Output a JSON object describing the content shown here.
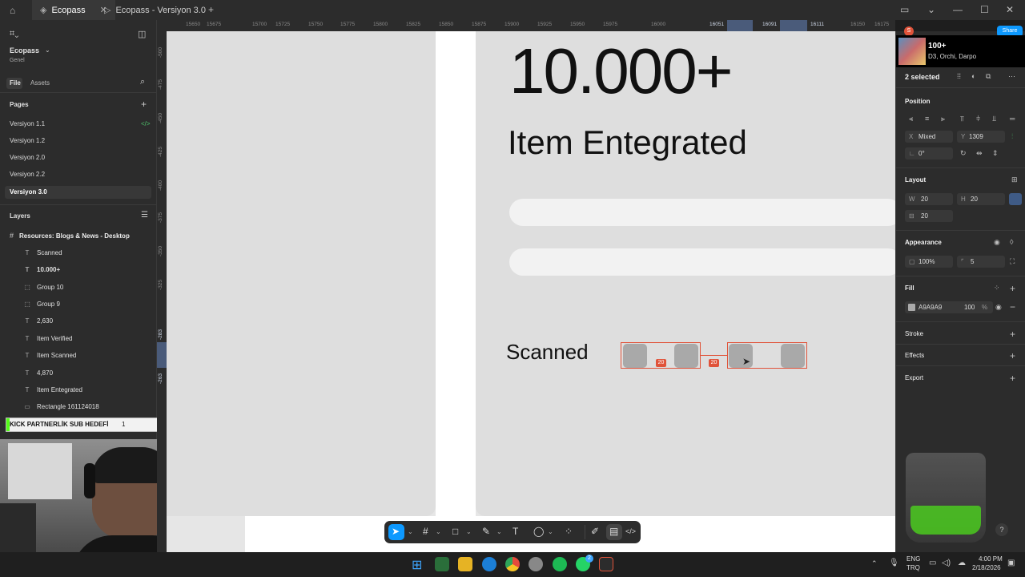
{
  "tabs": [
    {
      "label": "Ecopass",
      "active": true
    },
    {
      "label": "Ecopass - Versiyon 3.0",
      "active": false
    }
  ],
  "left_panel": {
    "project_name": "Ecopass",
    "team": "Genel",
    "tab_file": "File",
    "tab_assets": "Assets",
    "pages_header": "Pages",
    "pages": [
      "Versiyon 1.1",
      "Versiyon 1.2",
      "Versiyon 2.0",
      "Versiyon 2.2",
      "Versiyon 3.0"
    ],
    "layers_header": "Layers",
    "frame_name": "Resources: Blogs & News - Desktop",
    "layers": [
      {
        "icon": "text-icon",
        "label": "Scanned"
      },
      {
        "icon": "text-icon",
        "label": "10.000+"
      },
      {
        "icon": "group-icon",
        "label": "Group 10"
      },
      {
        "icon": "group-icon",
        "label": "Group 9"
      },
      {
        "icon": "text-icon",
        "label": "2,630"
      },
      {
        "icon": "text-icon",
        "label": "Item Verified"
      },
      {
        "icon": "text-icon",
        "label": "Item Scanned"
      },
      {
        "icon": "text-icon",
        "label": "4,870"
      },
      {
        "icon": "text-icon",
        "label": "Item Entegrated"
      },
      {
        "icon": "rect-icon",
        "label": "Rectangle 161124018"
      }
    ]
  },
  "overlay_bar": {
    "label": "KICK PARTNERLİK SUB HEDEFİ",
    "current": "1",
    "target": "25"
  },
  "ruler_top": [
    "15650",
    "15675",
    "15700",
    "15725",
    "15750",
    "15775",
    "15800",
    "15825",
    "15850",
    "15875",
    "15900",
    "15925",
    "15950",
    "15975",
    "16000",
    "16051",
    "16091",
    "16111",
    "16150",
    "16175"
  ],
  "ruler_left": [
    "-500",
    "-475",
    "-450",
    "-425",
    "-400",
    "-375",
    "-350",
    "-325",
    "-283",
    "-263"
  ],
  "canvas": {
    "big_number": "10.000+",
    "subtitle": "Item Entegrated",
    "scanned_label": "Scanned",
    "gap_badge_1": "20",
    "gap_badge_2": "20"
  },
  "right_panel": {
    "avatar_letter": "S",
    "share_label": "Share",
    "music": {
      "title": "100+",
      "artists": "D3, Orchi, Darpo"
    },
    "selection": "2 selected",
    "position_header": "Position",
    "x_label": "X",
    "x_value": "Mixed",
    "y_label": "Y",
    "y_value": "1309",
    "rotation": "0°",
    "layout_header": "Layout",
    "w_label": "W",
    "w_value": "20",
    "h_label": "H",
    "h_value": "20",
    "gap_value": "20",
    "appearance_header": "Appearance",
    "opacity": "100%",
    "radius": "5",
    "fill_header": "Fill",
    "fill_hex": "A9A9A9",
    "fill_opacity": "100",
    "fill_percent": "%",
    "stroke_header": "Stroke",
    "effects_header": "Effects",
    "export_header": "Export"
  },
  "taskbar": {
    "lang1": "ENG",
    "lang2": "TRQ",
    "time": "4:00 PM",
    "date": "2/18/2026",
    "whatsapp_badge": "2"
  },
  "colors": {
    "selection": "#e0533a",
    "accent": "#0d99ff",
    "fill_swatch": "#a9a9a9"
  }
}
